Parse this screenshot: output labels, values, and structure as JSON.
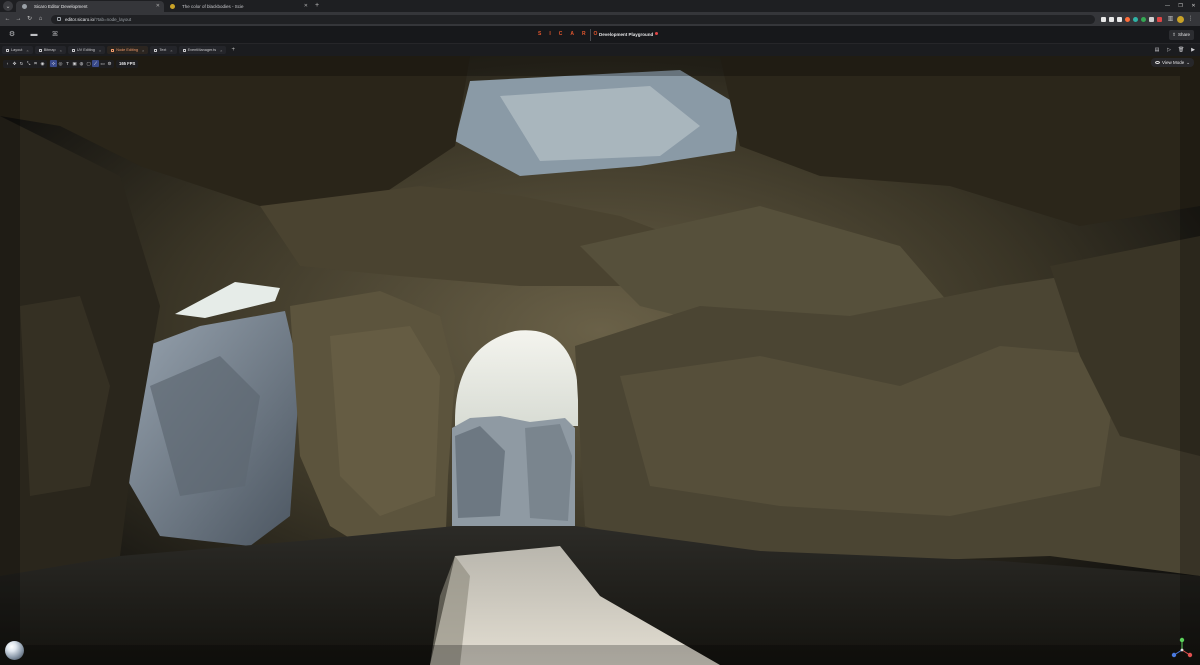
{
  "browser": {
    "tabs": [
      {
        "title": "Sicaro Editor Development",
        "active": true
      },
      {
        "title": "The color of blackbodies - Scie",
        "active": false
      }
    ],
    "url_host": "editor.sicaro.io",
    "url_path": "/?tab=node_layout",
    "extension_colors": [
      "#e8e8e8",
      "#e8e8e8",
      "#e8e8e8",
      "#ff6d3a",
      "#2fb3a6",
      "#34a853",
      "#d0d0d0",
      "#e04646"
    ]
  },
  "header": {
    "brand": "SICARO",
    "project_name": "Development Playground",
    "share_label": "Share"
  },
  "panel_tabs": [
    {
      "label": "Layout",
      "active": false
    },
    {
      "label": "Bitmap",
      "active": false
    },
    {
      "label": "UV Editing",
      "active": false
    },
    {
      "label": "Node Editing",
      "active": true
    },
    {
      "label": "Text",
      "active": false
    },
    {
      "label": "EventManager.ts",
      "active": false
    }
  ],
  "viewport": {
    "fps_label": "165 FPS",
    "view_mode_label": "View Mode"
  },
  "colors": {
    "accent": "#e4572e",
    "active_tab": "#f09a6a",
    "selection": "#3a4a8a"
  }
}
